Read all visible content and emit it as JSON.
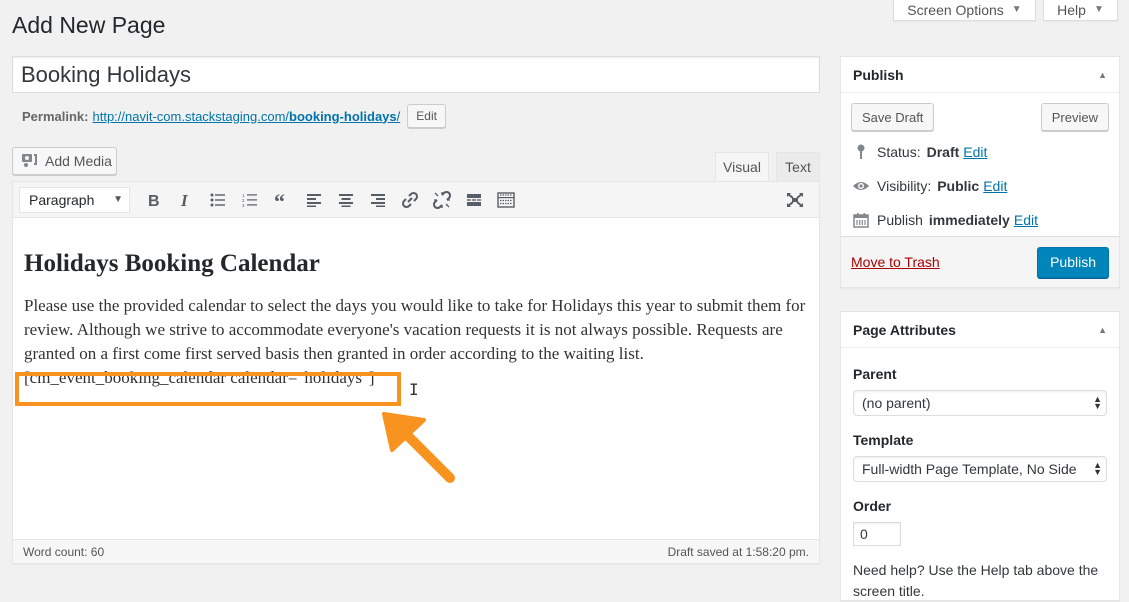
{
  "screen_meta": {
    "screen_options_label": "Screen Options",
    "help_label": "Help"
  },
  "page_title": "Add New Page",
  "post_title": {
    "value": "Booking Holidays"
  },
  "permalink": {
    "label": "Permalink:",
    "url_base": "http://navit-com.stackstaging.com/",
    "slug": "booking-holidays",
    "trailing": "/",
    "edit_label": "Edit"
  },
  "editor": {
    "add_media_label": "Add Media",
    "tabs": [
      {
        "label": "Visual",
        "active": true
      },
      {
        "label": "Text",
        "active": false
      }
    ],
    "format_select": "Paragraph",
    "toolbar_icons": [
      "bold-icon",
      "italic-icon",
      "bulleted-list-icon",
      "numbered-list-icon",
      "blockquote-icon",
      "align-left-icon",
      "align-center-icon",
      "align-right-icon",
      "insert-link-icon",
      "remove-link-icon",
      "read-more-icon",
      "toolbar-toggle-icon",
      "fullscreen-icon"
    ],
    "content": {
      "heading": "Holidays Booking Calendar",
      "paragraph": "Please use the provided calendar to select the days you would like to take for Holidays this year to submit them for review. Although we strive to accommodate everyone's vacation requests it is not always possible. Requests are granted on a first come first served basis then granted in order according to the waiting list.",
      "shortcode": "[cm_event_booking_calendar calendar=\"holidays\"]"
    },
    "annotation_color": "#f7931e",
    "word_count": "Word count: 60",
    "draft_saved": "Draft saved at 1:58:20 pm."
  },
  "publish_box": {
    "title": "Publish",
    "save_draft_label": "Save Draft",
    "preview_label": "Preview",
    "status_label": "Status:",
    "status_value": "Draft",
    "visibility_label": "Visibility:",
    "visibility_value": "Public",
    "publish_label": "Publish",
    "publish_value": "immediately",
    "edit_label": "Edit",
    "trash_label": "Move to Trash",
    "publish_button": "Publish",
    "primary_color": "#0085ba"
  },
  "attributes_box": {
    "title": "Page Attributes",
    "parent_label": "Parent",
    "parent_value": "(no parent)",
    "template_label": "Template",
    "template_value": "Full-width Page Template, No Side",
    "order_label": "Order",
    "order_value": "0",
    "help_text": "Need help? Use the Help tab above the screen title."
  }
}
